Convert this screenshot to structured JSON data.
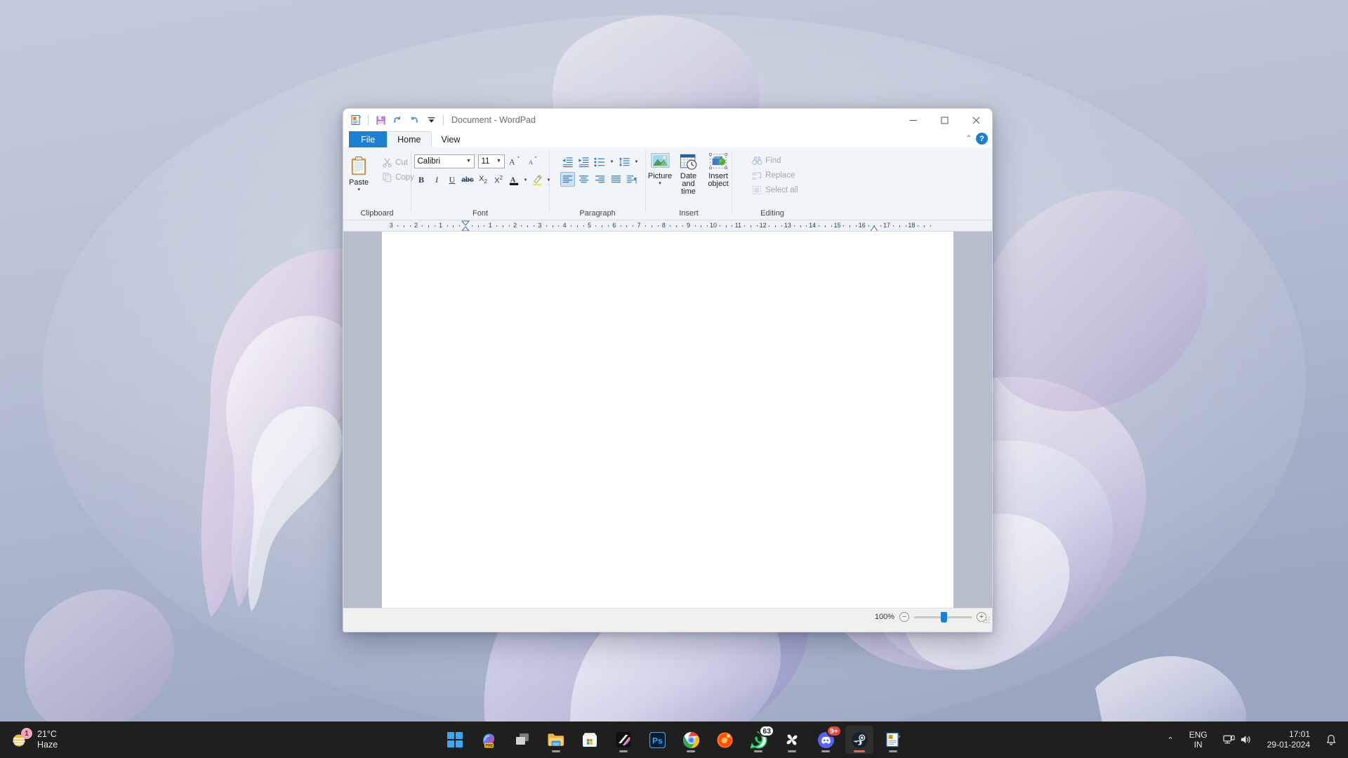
{
  "desktop": {
    "wallpaper_name": "windows-11-bloom-wallpaper",
    "bg_color": "#b9c2d4"
  },
  "window": {
    "title": "Document - WordPad",
    "quick_access": [
      {
        "name": "wordpad-app-icon",
        "label": "WordPad"
      },
      {
        "name": "save-icon",
        "label": "Save"
      },
      {
        "name": "undo-icon",
        "label": "Undo"
      },
      {
        "name": "redo-icon",
        "label": "Redo"
      },
      {
        "name": "customize-quick-access-icon",
        "label": "Customize Quick Access Toolbar"
      }
    ],
    "controls": {
      "minimize": "Minimize",
      "maximize": "Maximize",
      "close": "Close"
    }
  },
  "tabs": [
    {
      "id": "file",
      "label": "File"
    },
    {
      "id": "home",
      "label": "Home"
    },
    {
      "id": "view",
      "label": "View"
    }
  ],
  "tab_right": {
    "collapse_label": "Collapse the Ribbon",
    "help_label": "?"
  },
  "ribbon": {
    "groups": [
      {
        "id": "clipboard",
        "label": "Clipboard",
        "paste": {
          "label": "Paste",
          "caret": "▾"
        },
        "items": [
          {
            "name": "cut-button",
            "label": "Cut",
            "icon": "scissors-icon",
            "disabled": true
          },
          {
            "name": "copy-button",
            "label": "Copy",
            "icon": "copy-icon",
            "disabled": true
          }
        ]
      },
      {
        "id": "font",
        "label": "Font",
        "font_family": {
          "value": "Calibri",
          "placeholder": "Font family"
        },
        "font_size": {
          "value": "11",
          "placeholder": "Font size"
        },
        "grow": {
          "name": "grow-font-button",
          "label": "A▴"
        },
        "shrink": {
          "name": "shrink-font-button",
          "label": "A▾"
        },
        "buttons": [
          {
            "name": "bold-button",
            "label": "B"
          },
          {
            "name": "italic-button",
            "label": "I"
          },
          {
            "name": "underline-button",
            "label": "U"
          },
          {
            "name": "strikethrough-button",
            "label": "abc"
          },
          {
            "name": "subscript-button",
            "label": "X₂"
          },
          {
            "name": "superscript-button",
            "label": "X²"
          },
          {
            "name": "text-color-button",
            "label": "A"
          },
          {
            "name": "highlight-color-button",
            "label": "✎"
          }
        ]
      },
      {
        "id": "paragraph",
        "label": "Paragraph",
        "row1": [
          {
            "name": "decrease-indent-button",
            "label": "Decrease indent"
          },
          {
            "name": "increase-indent-button",
            "label": "Increase indent"
          },
          {
            "name": "bullets-button",
            "label": "Start a list"
          },
          {
            "name": "line-spacing-button",
            "label": "Line spacing"
          }
        ],
        "row2": [
          {
            "name": "align-left-button",
            "label": "Align left",
            "active": true
          },
          {
            "name": "align-center-button",
            "label": "Center"
          },
          {
            "name": "align-right-button",
            "label": "Align right"
          },
          {
            "name": "justify-button",
            "label": "Justify"
          },
          {
            "name": "paragraph-settings-button",
            "label": "Paragraph"
          }
        ]
      },
      {
        "id": "insert",
        "label": "Insert",
        "items": [
          {
            "name": "insert-picture-button",
            "label": "Picture",
            "caret": "▾",
            "icon": "picture-icon"
          },
          {
            "name": "insert-date-time-button",
            "label": "Date and\ntime",
            "icon": "date-time-icon"
          },
          {
            "name": "insert-object-button",
            "label": "Insert\nobject",
            "icon": "object-icon"
          }
        ]
      },
      {
        "id": "editing",
        "label": "Editing",
        "items": [
          {
            "name": "find-button",
            "label": "Find",
            "icon": "binoculars-icon",
            "disabled": true
          },
          {
            "name": "replace-button",
            "label": "Replace",
            "icon": "replace-icon",
            "disabled": true
          },
          {
            "name": "select-all-button",
            "label": "Select all",
            "icon": "select-all-icon",
            "disabled": true
          }
        ]
      }
    ]
  },
  "ruler": {
    "left_labels": [
      "3",
      "2",
      "1"
    ],
    "right_labels": [
      "1",
      "2",
      "3",
      "4",
      "5",
      "6",
      "7",
      "8",
      "9",
      "10",
      "11",
      "12",
      "13",
      "14",
      "15",
      "16",
      "17",
      "18"
    ],
    "left_indent_marker": "first-line-indent-marker",
    "right_indent_marker": "right-indent-marker"
  },
  "document": {
    "content": "",
    "page_color": "#ffffff"
  },
  "statusbar": {
    "zoom_percent": "100%",
    "zoom_out_label": "−",
    "zoom_in_label": "+",
    "zoom_value": 100
  },
  "taskbar": {
    "weather": {
      "temperature": "21°C",
      "condition": "Haze",
      "badge": "1"
    },
    "items": [
      {
        "name": "taskbar-start-button",
        "label": "Start",
        "icon": "windows-logo-icon",
        "running": false
      },
      {
        "name": "taskbar-copilot-button",
        "label": "Copilot",
        "icon": "copilot-icon",
        "badge_text": "PRE",
        "running": false
      },
      {
        "name": "taskbar-task-view-button",
        "label": "Task View",
        "icon": "task-view-icon",
        "running": false
      },
      {
        "name": "taskbar-file-explorer-button",
        "label": "File Explorer",
        "icon": "folder-icon",
        "running": true
      },
      {
        "name": "taskbar-microsoft-store-button",
        "label": "Microsoft Store",
        "icon": "store-icon",
        "running": false
      },
      {
        "name": "taskbar-snipping-tool-button",
        "label": "Snipping Tool",
        "icon": "snipping-tool-icon",
        "running": true
      },
      {
        "name": "taskbar-photoshop-button",
        "label": "Photoshop",
        "icon": "photoshop-icon",
        "running": false
      },
      {
        "name": "taskbar-chrome-button",
        "label": "Google Chrome",
        "icon": "chrome-icon",
        "running": true
      },
      {
        "name": "taskbar-firefox-button",
        "label": "Firefox",
        "icon": "firefox-icon",
        "running": false
      },
      {
        "name": "taskbar-whatsapp-button",
        "label": "WhatsApp",
        "icon": "whatsapp-icon",
        "badge_text": "63",
        "running": true
      },
      {
        "name": "taskbar-fan-app-button",
        "label": "Fan",
        "icon": "fan-icon",
        "running": true
      },
      {
        "name": "taskbar-discord-button",
        "label": "Discord",
        "icon": "discord-icon",
        "badge_text": "9+",
        "running": true
      },
      {
        "name": "taskbar-steam-button",
        "label": "Steam",
        "icon": "steam-icon",
        "running": true,
        "active": true
      },
      {
        "name": "taskbar-wordpad-button",
        "label": "WordPad",
        "icon": "wordpad-icon",
        "running": true
      }
    ],
    "tray": {
      "overflow": "⌃",
      "language": {
        "line1": "ENG",
        "line2": "IN"
      },
      "network_icon": "network-icon",
      "volume_icon": "volume-icon",
      "time": "17:01",
      "date": "29-01-2024",
      "notification_icon": "bell-icon"
    }
  }
}
